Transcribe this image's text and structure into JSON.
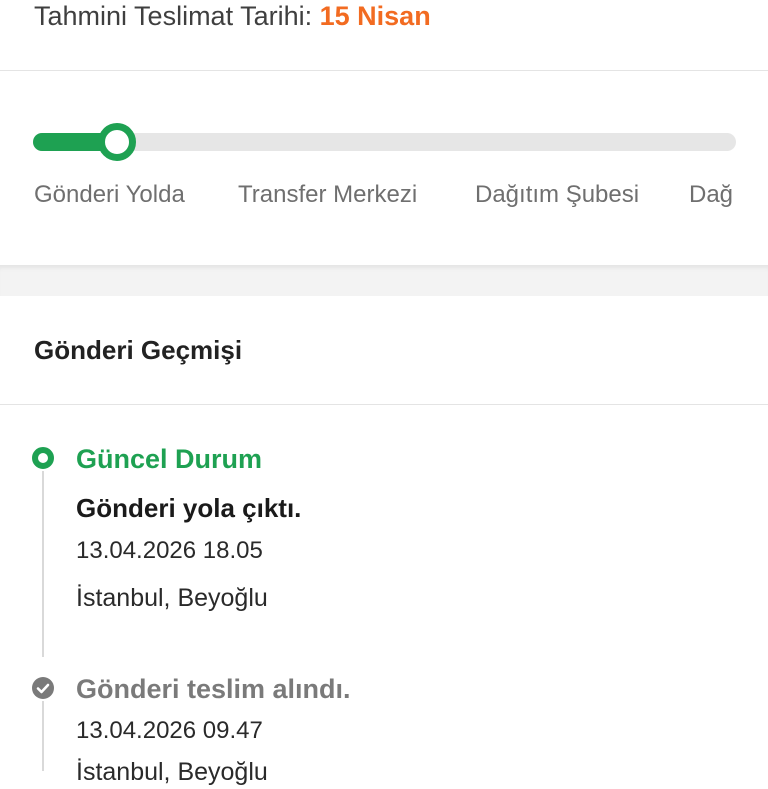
{
  "header": {
    "eta_label": "Tahmini Teslimat Tarihi:",
    "eta_date": "15 Nisan",
    "eta_color": "#f26b21"
  },
  "progress": {
    "completed_fraction": 0.12,
    "accent_color": "#1ea152",
    "steps": [
      "Gönderi Yolda",
      "Transfer Merkezi",
      "Dağıtım Şubesi",
      "Dağ"
    ]
  },
  "history": {
    "title": "Gönderi Geçmişi",
    "events": [
      {
        "status": "Güncel Durum",
        "description": "Gönderi yola çıktı.",
        "datetime": "13.04.2026 18.05",
        "location": "İstanbul, Beyoğlu",
        "icon": "current-ring-icon"
      },
      {
        "status": "Gönderi teslim alındı.",
        "datetime": "13.04.2026 09.47",
        "location": "İstanbul, Beyoğlu",
        "icon": "check-circle-icon"
      }
    ]
  }
}
